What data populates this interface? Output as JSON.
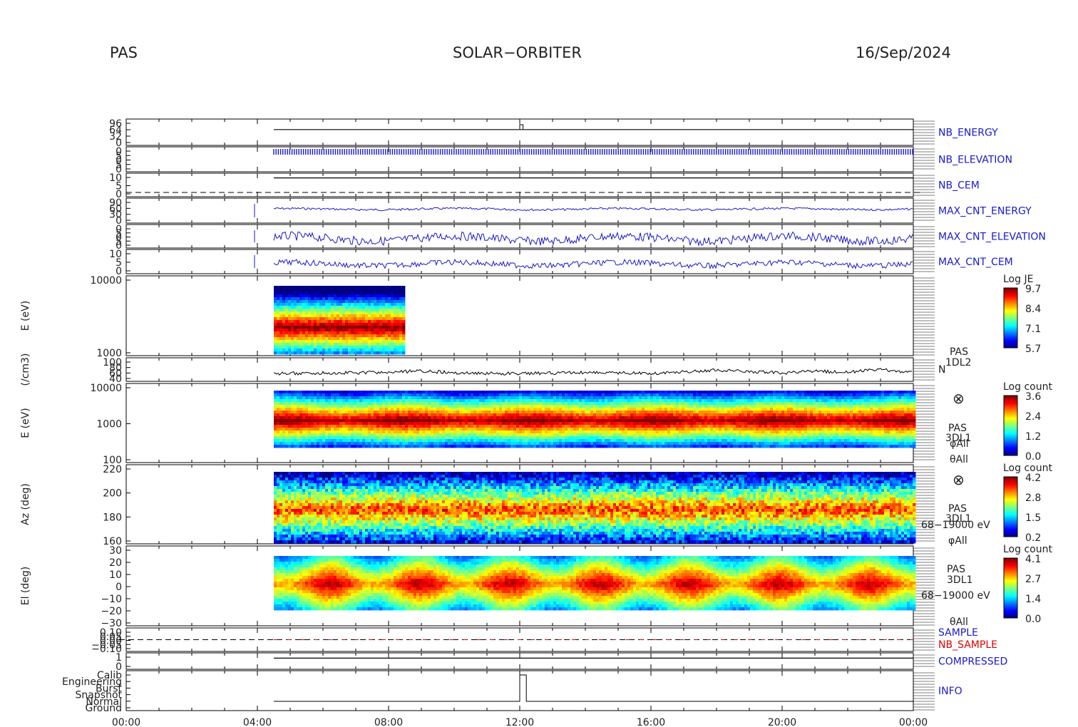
{
  "header": {
    "instrument": "PAS",
    "mission": "SOLAR−ORBITER",
    "date": "16/Sep/2024"
  },
  "x_ticks": [
    "00:00",
    "04:00",
    "08:00",
    "12:00",
    "16:00",
    "20:00",
    "00:00"
  ],
  "colors": {
    "blue": "#1a1acc",
    "red": "#e00000",
    "black": "#000000"
  },
  "panels": [
    {
      "id": "nb_energy",
      "right_label": "NB_ENERGY",
      "y_ticks": [
        "96",
        "64",
        "32",
        "0"
      ]
    },
    {
      "id": "nb_elevation",
      "right_label": "NB_ELEVATION",
      "y_ticks": [
        "0",
        "5",
        "0",
        "5",
        "0"
      ]
    },
    {
      "id": "nb_cem",
      "right_label": "NB_CEM",
      "y_ticks": [
        "10",
        "5",
        "0"
      ]
    },
    {
      "id": "max_cnt_energy",
      "right_label": "MAX_CNT_ENERGY",
      "y_ticks": [
        "90",
        "60",
        "30",
        "0"
      ]
    },
    {
      "id": "max_cnt_elevation",
      "right_label": "MAX_CNT_ELEVATION",
      "y_ticks": [
        "0",
        "5",
        "0",
        "5",
        "0"
      ]
    },
    {
      "id": "max_cnt_cem",
      "right_label": "MAX_CNT_CEM",
      "y_ticks": [
        "10",
        "5",
        "0"
      ]
    },
    {
      "id": "energy_1dl2",
      "y_label": "E (eV)",
      "y_ticks": [
        "10000",
        "1000"
      ],
      "colorbar": {
        "title": "Log JE",
        "ticks": [
          "9.7",
          "8.4",
          "7.1",
          "5.7"
        ]
      }
    },
    {
      "id": "density",
      "y_label": "(/cm3)",
      "y_ticks": [
        "100",
        "80",
        "60",
        "40"
      ],
      "right_labels": [
        "PAS",
        "1DL2",
        "N"
      ]
    },
    {
      "id": "energy_3dl1",
      "y_label": "E (eV)",
      "y_ticks": [
        "10000",
        "1000",
        "100"
      ],
      "right_labels": [
        "⊗",
        "PAS",
        "3DL1",
        "φAll",
        "θAll"
      ],
      "colorbar": {
        "title": "Log count",
        "ticks": [
          "3.6",
          "2.4",
          "1.2",
          "0.0"
        ]
      }
    },
    {
      "id": "azimuth",
      "y_label": "Az (deg)",
      "y_ticks": [
        "220",
        "200",
        "180",
        "160"
      ],
      "right_labels": [
        "⊗",
        "PAS",
        "3DL1",
        "68−19000 eV",
        "φAll"
      ],
      "colorbar": {
        "title": "Log count",
        "ticks": [
          "4.2",
          "2.8",
          "1.5",
          "0.2"
        ]
      }
    },
    {
      "id": "elevation",
      "y_label": "El (deg)",
      "y_ticks": [
        "30",
        "20",
        "10",
        "0",
        "−10",
        "−20",
        "−30"
      ],
      "right_labels": [
        "PAS",
        "3DL1",
        "68−19000 eV",
        "θAll"
      ],
      "colorbar": {
        "title": "Log count",
        "ticks": [
          "4.1",
          "2.7",
          "1.4",
          "0.0"
        ]
      }
    },
    {
      "id": "sample",
      "right_labels": [
        "SAMPLE",
        "NB_SAMPLE"
      ],
      "y_ticks": [
        "0.10",
        "0.05",
        "0.00",
        "−0.05",
        "−0.10"
      ]
    },
    {
      "id": "compressed",
      "right_label": "COMPRESSED",
      "y_ticks": [
        "1",
        "0"
      ]
    },
    {
      "id": "info",
      "right_label": "INFO",
      "y_ticks": [
        "Calib",
        "Engineering",
        "Burst",
        "Snapshot",
        "Normal",
        "Ground"
      ]
    }
  ],
  "chart_data": {
    "type": "heatmap",
    "x_range_hours": [
      0,
      24
    ],
    "data_start_hours": 4.5,
    "moment_end_hours": 8.5,
    "series": [
      {
        "name": "N",
        "x": [
          4.5,
          6,
          8,
          9,
          10,
          12,
          14,
          16,
          18,
          19,
          20,
          21,
          22,
          23,
          24
        ],
        "values": [
          58,
          60,
          62,
          68,
          60,
          58,
          62,
          58,
          70,
          66,
          60,
          66,
          64,
          72,
          62
        ]
      }
    ]
  }
}
